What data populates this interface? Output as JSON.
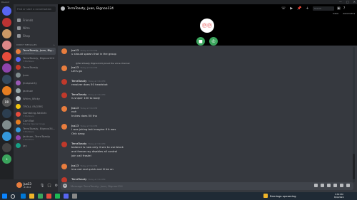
{
  "window": {
    "title": "Discord",
    "controls": [
      "—",
      "□",
      "✕"
    ]
  },
  "servers": [
    {
      "icon": "discord-home-icon",
      "color": "#5865f2",
      "label": ""
    },
    {
      "color": "#b33",
      "label": ""
    },
    {
      "color": "#c96",
      "label": ""
    },
    {
      "color": "#d88",
      "label": ""
    },
    {
      "color": "#e74c3c",
      "label": ""
    },
    {
      "color": "#8e44ad",
      "label": ""
    },
    {
      "color": "#34495e",
      "label": ""
    },
    {
      "color": "#e67e22",
      "label": ""
    },
    {
      "color": "#555",
      "label": "DR"
    },
    {
      "color": "#2c3e50",
      "label": ""
    },
    {
      "color": "#7f8c8d",
      "label": ""
    },
    {
      "color": "#3498db",
      "label": ""
    },
    {
      "color": "#444",
      "label": ""
    },
    {
      "color": "#3ba55d",
      "label": "+",
      "icon": "add-server-icon"
    }
  ],
  "sidebar": {
    "search_placeholder": "Find or start a conversation",
    "nav": [
      {
        "label": "Friends",
        "icon": "friends-icon"
      },
      {
        "label": "Nitro",
        "icon": "nitro-icon"
      },
      {
        "label": "Shop",
        "icon": "shop-icon"
      }
    ],
    "dm_header": "DIRECT MESSAGES",
    "dm_add": "+",
    "dms": [
      {
        "name": "TerraToasty, Juan, Bign...",
        "sub": "4 Members",
        "color": "#e87d3e",
        "active": true
      },
      {
        "name": "TerraToasty, Bignoo124",
        "sub": "3 Members",
        "color": "#5865f2",
        "active": false
      },
      {
        "name": "TerraToasty",
        "sub": "",
        "color": "#c0392b",
        "active": false
      },
      {
        "name": "Juan",
        "sub": "",
        "color": "#7f8c8d",
        "active": false
      },
      {
        "name": "jhospsarty",
        "sub": "",
        "color": "#9b59b6",
        "active": false
      },
      {
        "name": "Jackson",
        "sub": "",
        "color": "#95a5a6",
        "active": false
      },
      {
        "name": "Whim_Wicky",
        "sub": "",
        "color": "#bdc3c7",
        "active": false
      },
      {
        "name": "TROLL FACERS",
        "sub": "",
        "color": "#f1c40f",
        "active": false
      },
      {
        "name": "Gambling Addicts",
        "sub": "3 Members",
        "color": "#e74c3c",
        "active": false
      },
      {
        "name": "Cart Bot",
        "sub": "Playing Spaces Conga",
        "color": "#e67e22",
        "active": false
      },
      {
        "name": "TerraToasty, Bignoo34...",
        "sub": "3 Members",
        "color": "#3498db",
        "active": false
      },
      {
        "name": "Jackson, TerraToasty",
        "sub": "2 Members",
        "color": "#8e44ad",
        "active": false
      },
      {
        "name": "jay",
        "sub": "",
        "color": "#16a085",
        "active": false
      }
    ]
  },
  "user": {
    "name": "Jus13",
    "tag": "#1394"
  },
  "call": {
    "title": "TerraToasty, Juan, Bignoo124",
    "search_placeholder": "Search",
    "labels": [
      "Inbox",
      "Automatics"
    ],
    "avatar_text": "ⓟⓟ"
  },
  "messages": [
    {
      "author": "Jus13",
      "time": "Today at 3:16 PM",
      "lines": [
        "u should spawn that in the group"
      ],
      "color": "#e87d3e",
      "reply": ""
    },
    {
      "author": "Jus13",
      "time": "Today at 3:16 PM",
      "lines": [
        "Let's go"
      ],
      "color": "#e87d3e",
      "reply": "@TerraToasty: Bignoo124 joined the voice channel"
    },
    {
      "author": "TerraToasty",
      "time": "Today at 3:16 PM",
      "lines": [
        "revolver does 50 headshot"
      ],
      "color": "#c0392b",
      "reply": ""
    },
    {
      "author": "TerraToasty",
      "time": "Today at 3:16 PM",
      "lines": [
        "is sniper 150 to body"
      ],
      "color": "#c0392b",
      "reply": ""
    },
    {
      "author": "Jus13",
      "time": "Today at 3:16 PM",
      "lines": [
        "nah",
        "knives does 50 tho"
      ],
      "color": "#e87d3e",
      "reply": ""
    },
    {
      "author": "Jus13",
      "time": "Today at 3:16 PM",
      "lines": [
        "I was joking but imagine if it was",
        "Ohh dang"
      ],
      "color": "#e87d3e",
      "reply": ""
    },
    {
      "author": "TerraToasty",
      "time": "Today at 3:16 PM",
      "lines": [
        "balance is now only 4 sec to use block",
        "and freeze ray disables all control",
        "join call frostel"
      ],
      "color": "#c0392b",
      "reply": ""
    },
    {
      "author": "Jus13",
      "time": "Today at 3:16 PM",
      "lines": [
        "ima eat real quick and lll be on"
      ],
      "color": "#e87d3e",
      "reply": ""
    },
    {
      "author": "TerraToasty",
      "time": "Today at 3:16 PM",
      "lines": [
        "ok"
      ],
      "color": "#c0392b",
      "reply": ""
    }
  ],
  "composer": {
    "placeholder": "Message TerraToasty, Juan, Bignoo124"
  },
  "taskbar": {
    "tray_text": "Earnings upcoming",
    "clock_time": "3:30 PM",
    "clock_date": "8/4/2024",
    "apps": [
      "#0078d7",
      "#f0b429",
      "#3ba55d",
      "#e74c3c",
      "#1db954",
      "#5865f2",
      "#888"
    ]
  }
}
